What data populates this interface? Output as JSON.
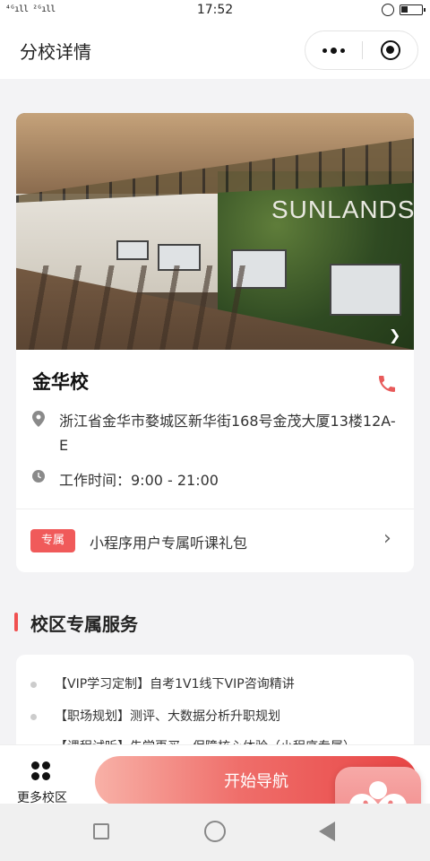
{
  "status_bar": {
    "signal": "⁴ᴳıll ²ᴳıll",
    "time": "17:52"
  },
  "nav_bar": {
    "title": "分校详情"
  },
  "school": {
    "photo_logo": "SUNLANDS",
    "name": "金华校",
    "address": "浙江省金华市婺城区新华街168号金茂大厦13楼12A-E",
    "hours": "工作时间：9:00 - 21:00",
    "gift": {
      "badge": "专属",
      "text": "小程序用户专属听课礼包"
    }
  },
  "services_section": {
    "title": "校区专属服务",
    "items": [
      "【VIP学习定制】自考1V1线下VIP咨询精讲",
      "【职场规划】测评、大数据分析升职规划",
      "【课程试听】先学再买，保障核心体验（小程序专属）"
    ]
  },
  "bottom_bar": {
    "more_label": "更多校区",
    "start_nav_label": "开始导航"
  },
  "colors": {
    "accent": "#f05a5a",
    "phone_icon": "#e85a5a",
    "page_background": "#f3f3f5"
  },
  "icons": {
    "status": [
      "lock-icon",
      "battery-icon"
    ],
    "capsule": [
      "more-icon",
      "close-circle-icon"
    ],
    "school": [
      "phone-icon",
      "location-pin-icon",
      "clock-icon",
      "chevron-right-icon"
    ],
    "bottom": [
      "grid-icon",
      "heart-float-icon"
    ],
    "system_nav": [
      "recent-apps-icon",
      "home-icon",
      "back-icon"
    ]
  }
}
